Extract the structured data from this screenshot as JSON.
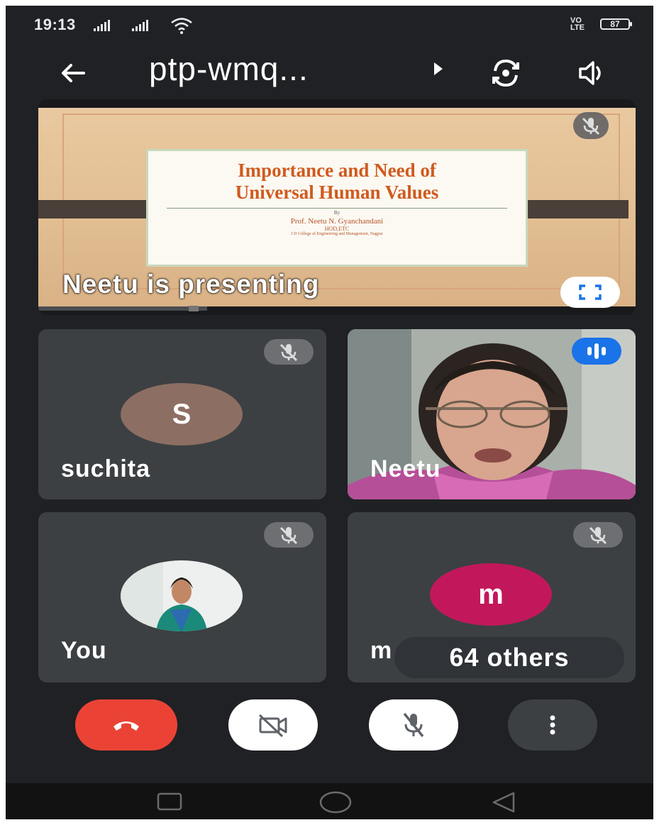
{
  "status_bar": {
    "time": "19:13",
    "volte": "VO LTE",
    "battery": "87"
  },
  "header": {
    "title": "ptp-wmq...",
    "icons": [
      "back-arrow-icon",
      "switch-camera-icon",
      "speaker-icon"
    ]
  },
  "presentation": {
    "slide_title_line1": "Importance and Need of",
    "slide_title_line2": "Universal Human Values",
    "slide_by": "By",
    "slide_author": "Prof. Neetu N. Gyanchandani",
    "slide_dept": "HOD,ETC",
    "slide_college": "J D College of Engineering and Management, Nagpur",
    "label": "Neetu is presenting",
    "icons": [
      "mic-off-icon",
      "fullscreen-icon"
    ]
  },
  "participants": [
    {
      "name": "suchita",
      "initial": "S",
      "color": "#8d6e63",
      "state": "muted"
    },
    {
      "name": "Neetu",
      "state": "speaking"
    },
    {
      "name": "You",
      "state": "muted"
    },
    {
      "name": "m",
      "initial": "m",
      "color": "#c2185b",
      "state": "muted"
    }
  ],
  "others_chip": "64 others",
  "controls": [
    "end-call-icon",
    "camera-off-icon",
    "mic-off-icon",
    "more-options-icon"
  ],
  "colors": {
    "background": "#202124",
    "tile": "#3c4043",
    "end_call": "#ea4335",
    "speaking": "#1a73e8"
  }
}
